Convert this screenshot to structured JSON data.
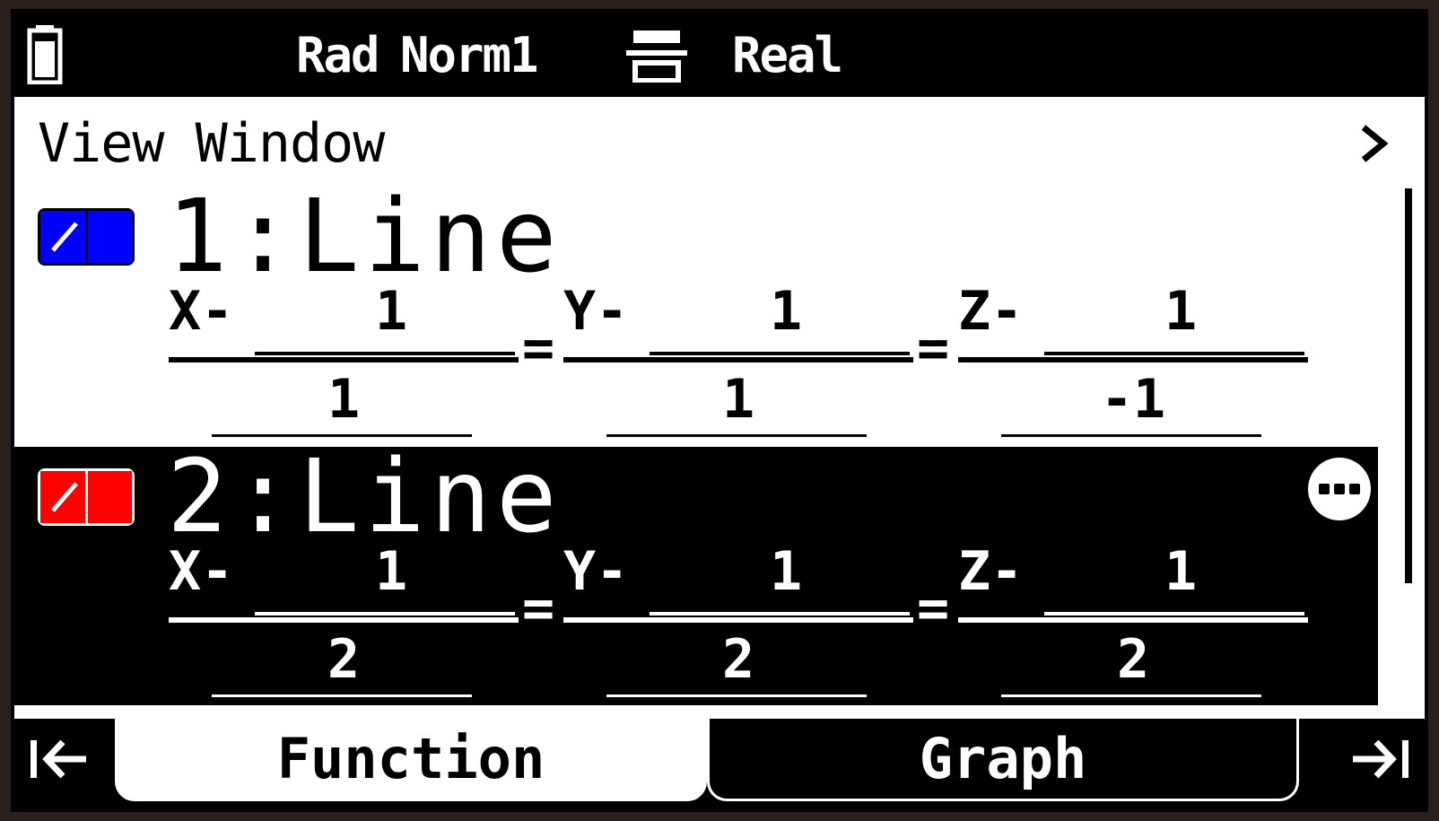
{
  "status": {
    "angle": "Rad",
    "display": "Norm1",
    "complex": "Real",
    "battery_icon": "battery-icon",
    "format_icon": "display-format-icon"
  },
  "title": "View Window",
  "entries": [
    {
      "label": "1:Line",
      "color": "#0000ff",
      "selected": false,
      "fractions": [
        {
          "var": "X-",
          "num": "1",
          "den": "1"
        },
        {
          "var": "Y-",
          "num": "1",
          "den": "1"
        },
        {
          "var": "Z-",
          "num": "1",
          "den": "-1"
        }
      ]
    },
    {
      "label": "2:Line",
      "color": "#ff0000",
      "selected": true,
      "fractions": [
        {
          "var": "X-",
          "num": "1",
          "den": "2"
        },
        {
          "var": "Y-",
          "num": "1",
          "den": "2"
        },
        {
          "var": "Z-",
          "num": "1",
          "den": "2"
        }
      ]
    }
  ],
  "eq_sign": "=",
  "tabs": {
    "left": "Function",
    "right": "Graph"
  }
}
